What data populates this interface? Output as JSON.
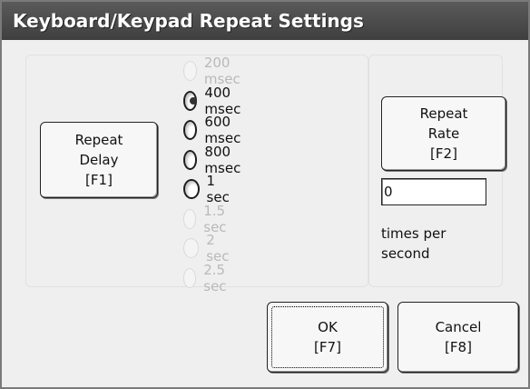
{
  "dialog": {
    "title": "Keyboard/Keypad Repeat Settings"
  },
  "repeat_delay_button": {
    "line1": "Repeat",
    "line2": "Delay",
    "line3": "[F1]"
  },
  "delay_options": [
    {
      "label": "200 msec",
      "enabled": false,
      "selected": false
    },
    {
      "label": "400 msec",
      "enabled": true,
      "selected": true
    },
    {
      "label": "600 msec",
      "enabled": true,
      "selected": false
    },
    {
      "label": "800 msec",
      "enabled": true,
      "selected": false
    },
    {
      "label": "1 sec",
      "enabled": true,
      "selected": false
    },
    {
      "label": "1.5 sec",
      "enabled": false,
      "selected": false
    },
    {
      "label": "2 sec",
      "enabled": false,
      "selected": false
    },
    {
      "label": "2.5 sec",
      "enabled": false,
      "selected": false
    }
  ],
  "repeat_rate_button": {
    "line1": "Repeat",
    "line2": "Rate",
    "line3": "[F2]"
  },
  "repeat_rate": {
    "value": "0",
    "caption_line1": "times per",
    "caption_line2": "second"
  },
  "ok_button": {
    "line1": "OK",
    "line2": "[F7]"
  },
  "cancel_button": {
    "line1": "Cancel",
    "line2": "[F8]"
  },
  "colors": {
    "titlebar": "#4a4a4a",
    "background": "#efefef",
    "disabled_text": "#b9b9b9"
  }
}
